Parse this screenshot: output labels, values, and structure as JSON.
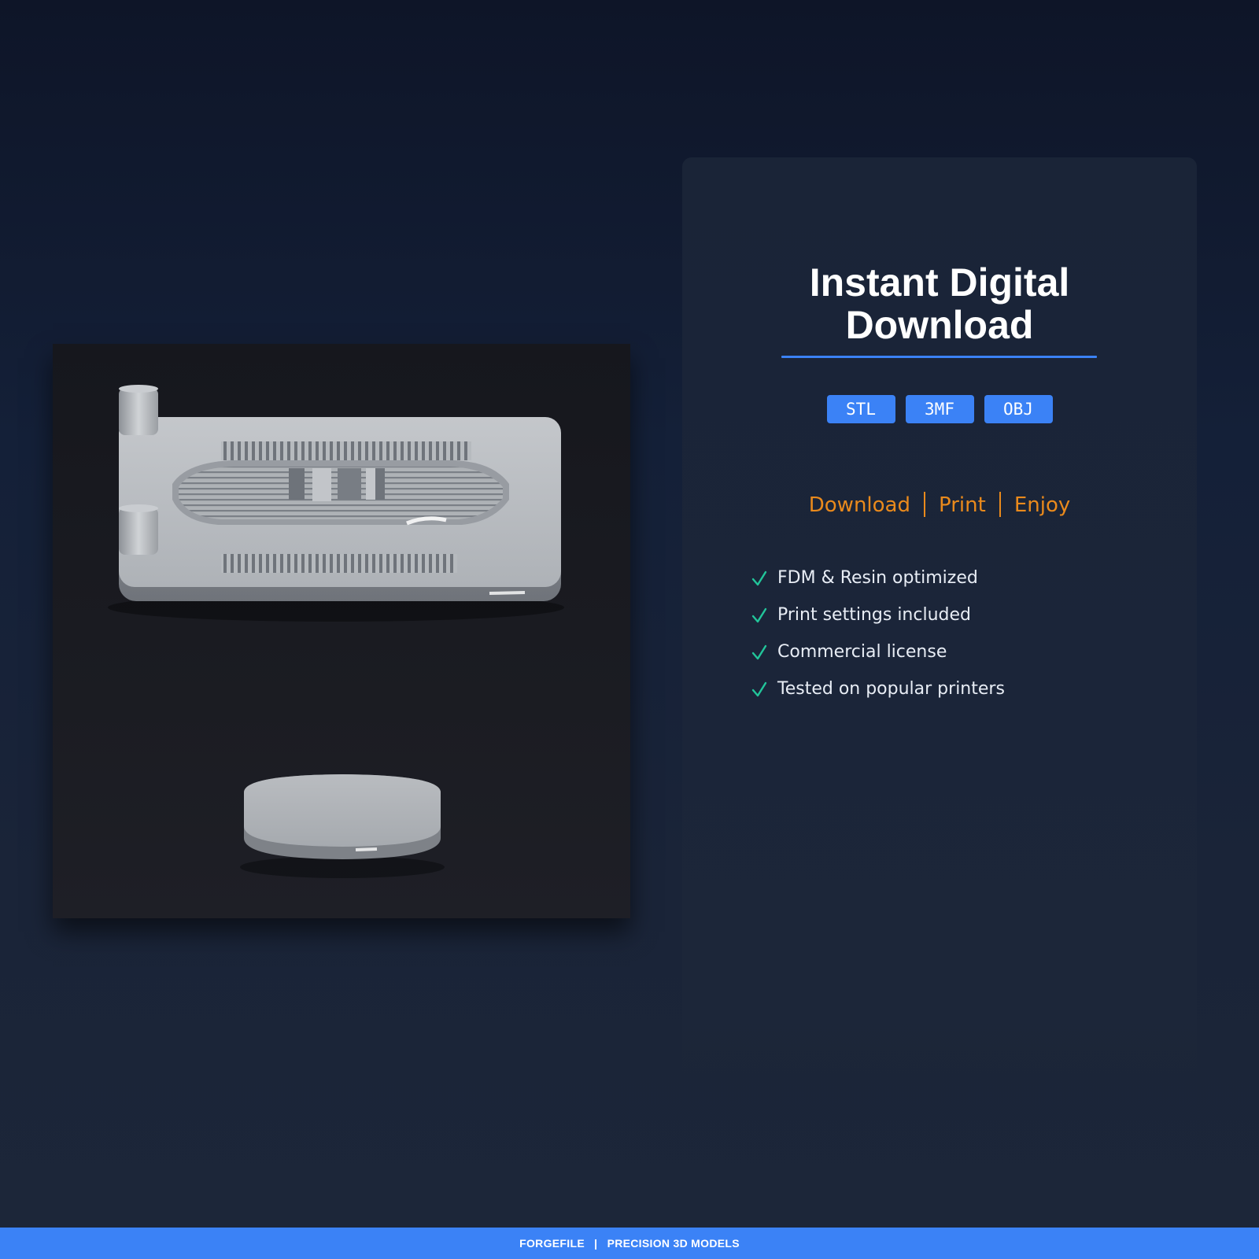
{
  "card": {
    "title_line1": "Instant Digital",
    "title_line2": "Download",
    "accent_color": "#3b82f6",
    "formats": [
      "STL",
      "3MF",
      "OBJ"
    ],
    "steps": [
      "Download",
      "Print",
      "Enjoy"
    ],
    "steps_color": "#ea8a1c",
    "features": [
      "FDM & Resin optimized",
      "Print settings included",
      "Commercial license",
      "Tested on popular printers"
    ],
    "check_icon": "check-icon",
    "check_color": "#22c59a"
  },
  "render": {
    "description_icon": "product-3d-render"
  },
  "footer": {
    "brand": "FORGEFILE",
    "divider": "|",
    "tagline": "PRECISION 3D MODELS",
    "color": "#3b82f6"
  }
}
